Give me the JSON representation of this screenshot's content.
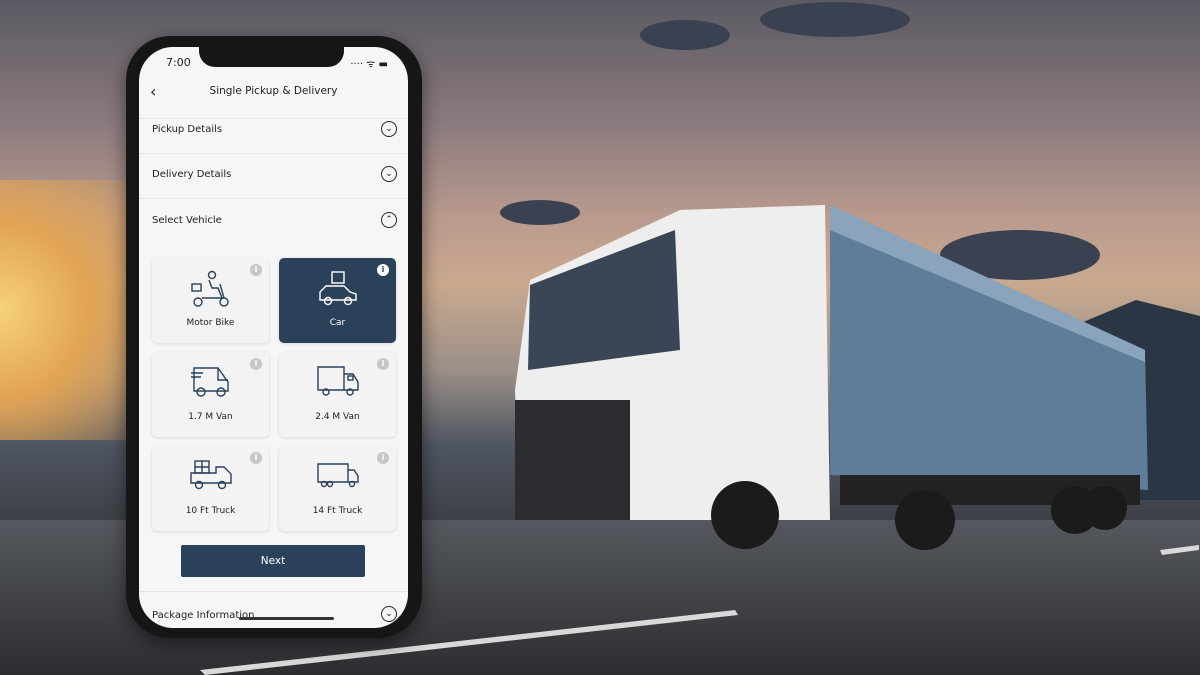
{
  "status_bar": {
    "time": "7:00",
    "icons": "···· ᯤ ▬"
  },
  "header": {
    "back_icon": "‹",
    "title": "Single Pickup & Delivery"
  },
  "sections": [
    {
      "label": "Pickup Details",
      "state": "collapsed",
      "icon": "⌄"
    },
    {
      "label": "Delivery Details",
      "state": "collapsed",
      "icon": "⌄"
    },
    {
      "label": "Select Vehicle",
      "state": "expanded",
      "icon": "⌃"
    },
    {
      "label": "Package Information",
      "state": "collapsed",
      "icon": "⌄"
    }
  ],
  "vehicles": [
    {
      "label": "Motor Bike",
      "selected": false,
      "icon": "motorbike-icon"
    },
    {
      "label": "Car",
      "selected": true,
      "icon": "car-icon"
    },
    {
      "label": "1.7 M Van",
      "selected": false,
      "icon": "van-icon"
    },
    {
      "label": "2.4 M Van",
      "selected": false,
      "icon": "box-van-icon"
    },
    {
      "label": "10 Ft Truck",
      "selected": false,
      "icon": "pickup-truck-icon"
    },
    {
      "label": "14 Ft Truck",
      "selected": false,
      "icon": "box-truck-icon"
    }
  ],
  "info_glyph": "i",
  "next_label": "Next",
  "colors": {
    "accent": "#2a4159",
    "icon_stroke": "#2a4159"
  }
}
